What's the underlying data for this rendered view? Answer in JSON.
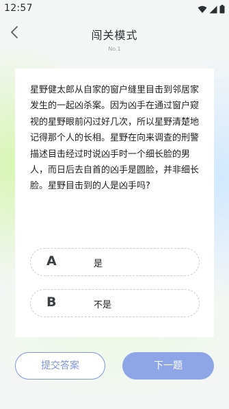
{
  "status_bar": {
    "time": "12:57",
    "icons": [
      "wifi-icon",
      "signal-icon",
      "battery-icon"
    ]
  },
  "header": {
    "back_icon": "chevron-left-icon",
    "title": "闯关模式",
    "level": "No.1"
  },
  "question": {
    "text": "星野健太郎从自家的窗户缝里目击到邻居家发生的一起凶杀案。因为凶手在通过窗户窥视的星野眼前闪过好几次，所以星野清楚地记得那个人的长相。星野在向来调查的刑警描述目击经过时说凶手时一个细长脸的男人，而日后去自首的凶手是圆脸，并非细长脸。星野目击到的人是凶手吗?"
  },
  "options": [
    {
      "letter": "A",
      "text": "是"
    },
    {
      "letter": "B",
      "text": "不是"
    }
  ],
  "actions": {
    "submit_label": "提交答案",
    "next_label": "下一题"
  },
  "colors": {
    "accent": "#8ea6e6",
    "accent_border": "#7e95d8",
    "text": "#222222",
    "option_border": "#c7cdd0"
  }
}
